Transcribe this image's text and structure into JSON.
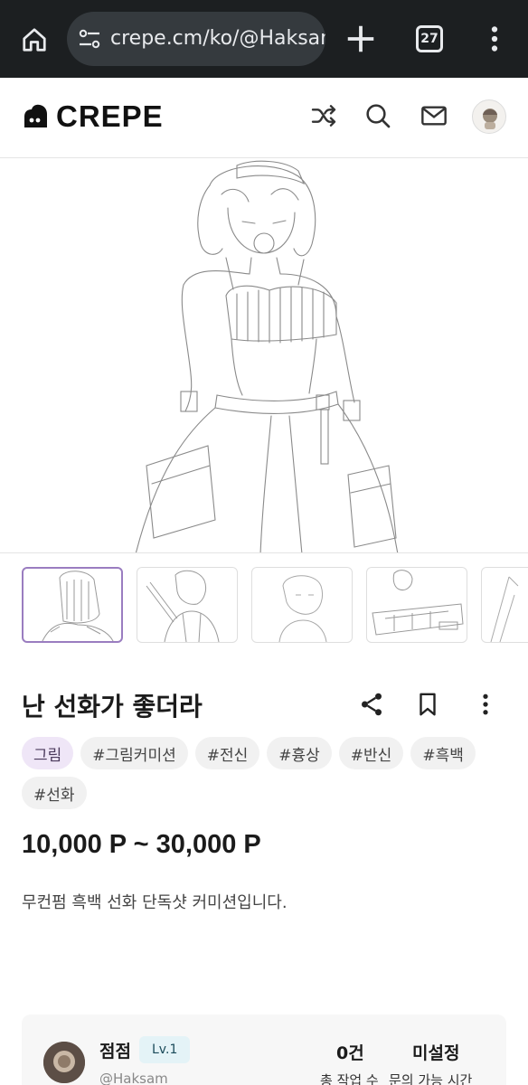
{
  "browser": {
    "url": "crepe.cm/ko/@Haksam",
    "tab_count": "27"
  },
  "site": {
    "logo_text": "CREPE"
  },
  "post": {
    "title": "난 선화가 좋더라",
    "tags": [
      "그림",
      "#그림커미션",
      "#전신",
      "#흉상",
      "#반신",
      "#흑백",
      "#선화"
    ],
    "price": "10,000 P ~ 30,000 P",
    "description": "무컨펌 흑백 선화 단독샷 커미션입니다."
  },
  "seller": {
    "name": "점점",
    "level": "Lv.1",
    "handle": "@Haksam",
    "works_value": "0건",
    "works_label": "총 작업 수",
    "hours_value": "미설정",
    "hours_label": "문의 가능 시간"
  },
  "colors": {
    "chrome_bg": "#1c1f21",
    "accent_border": "#9a7dc0",
    "primary_tag_bg": "#efe6f7",
    "level_badge_bg": "#e4f3f7"
  },
  "icons": {
    "home": "home-icon",
    "site_settings": "tune-icon",
    "new_tab": "plus-icon",
    "menu": "more-vert-icon",
    "shuffle": "shuffle-icon",
    "search": "search-icon",
    "mail": "mail-icon",
    "share": "share-icon",
    "bookmark": "bookmark-icon"
  }
}
